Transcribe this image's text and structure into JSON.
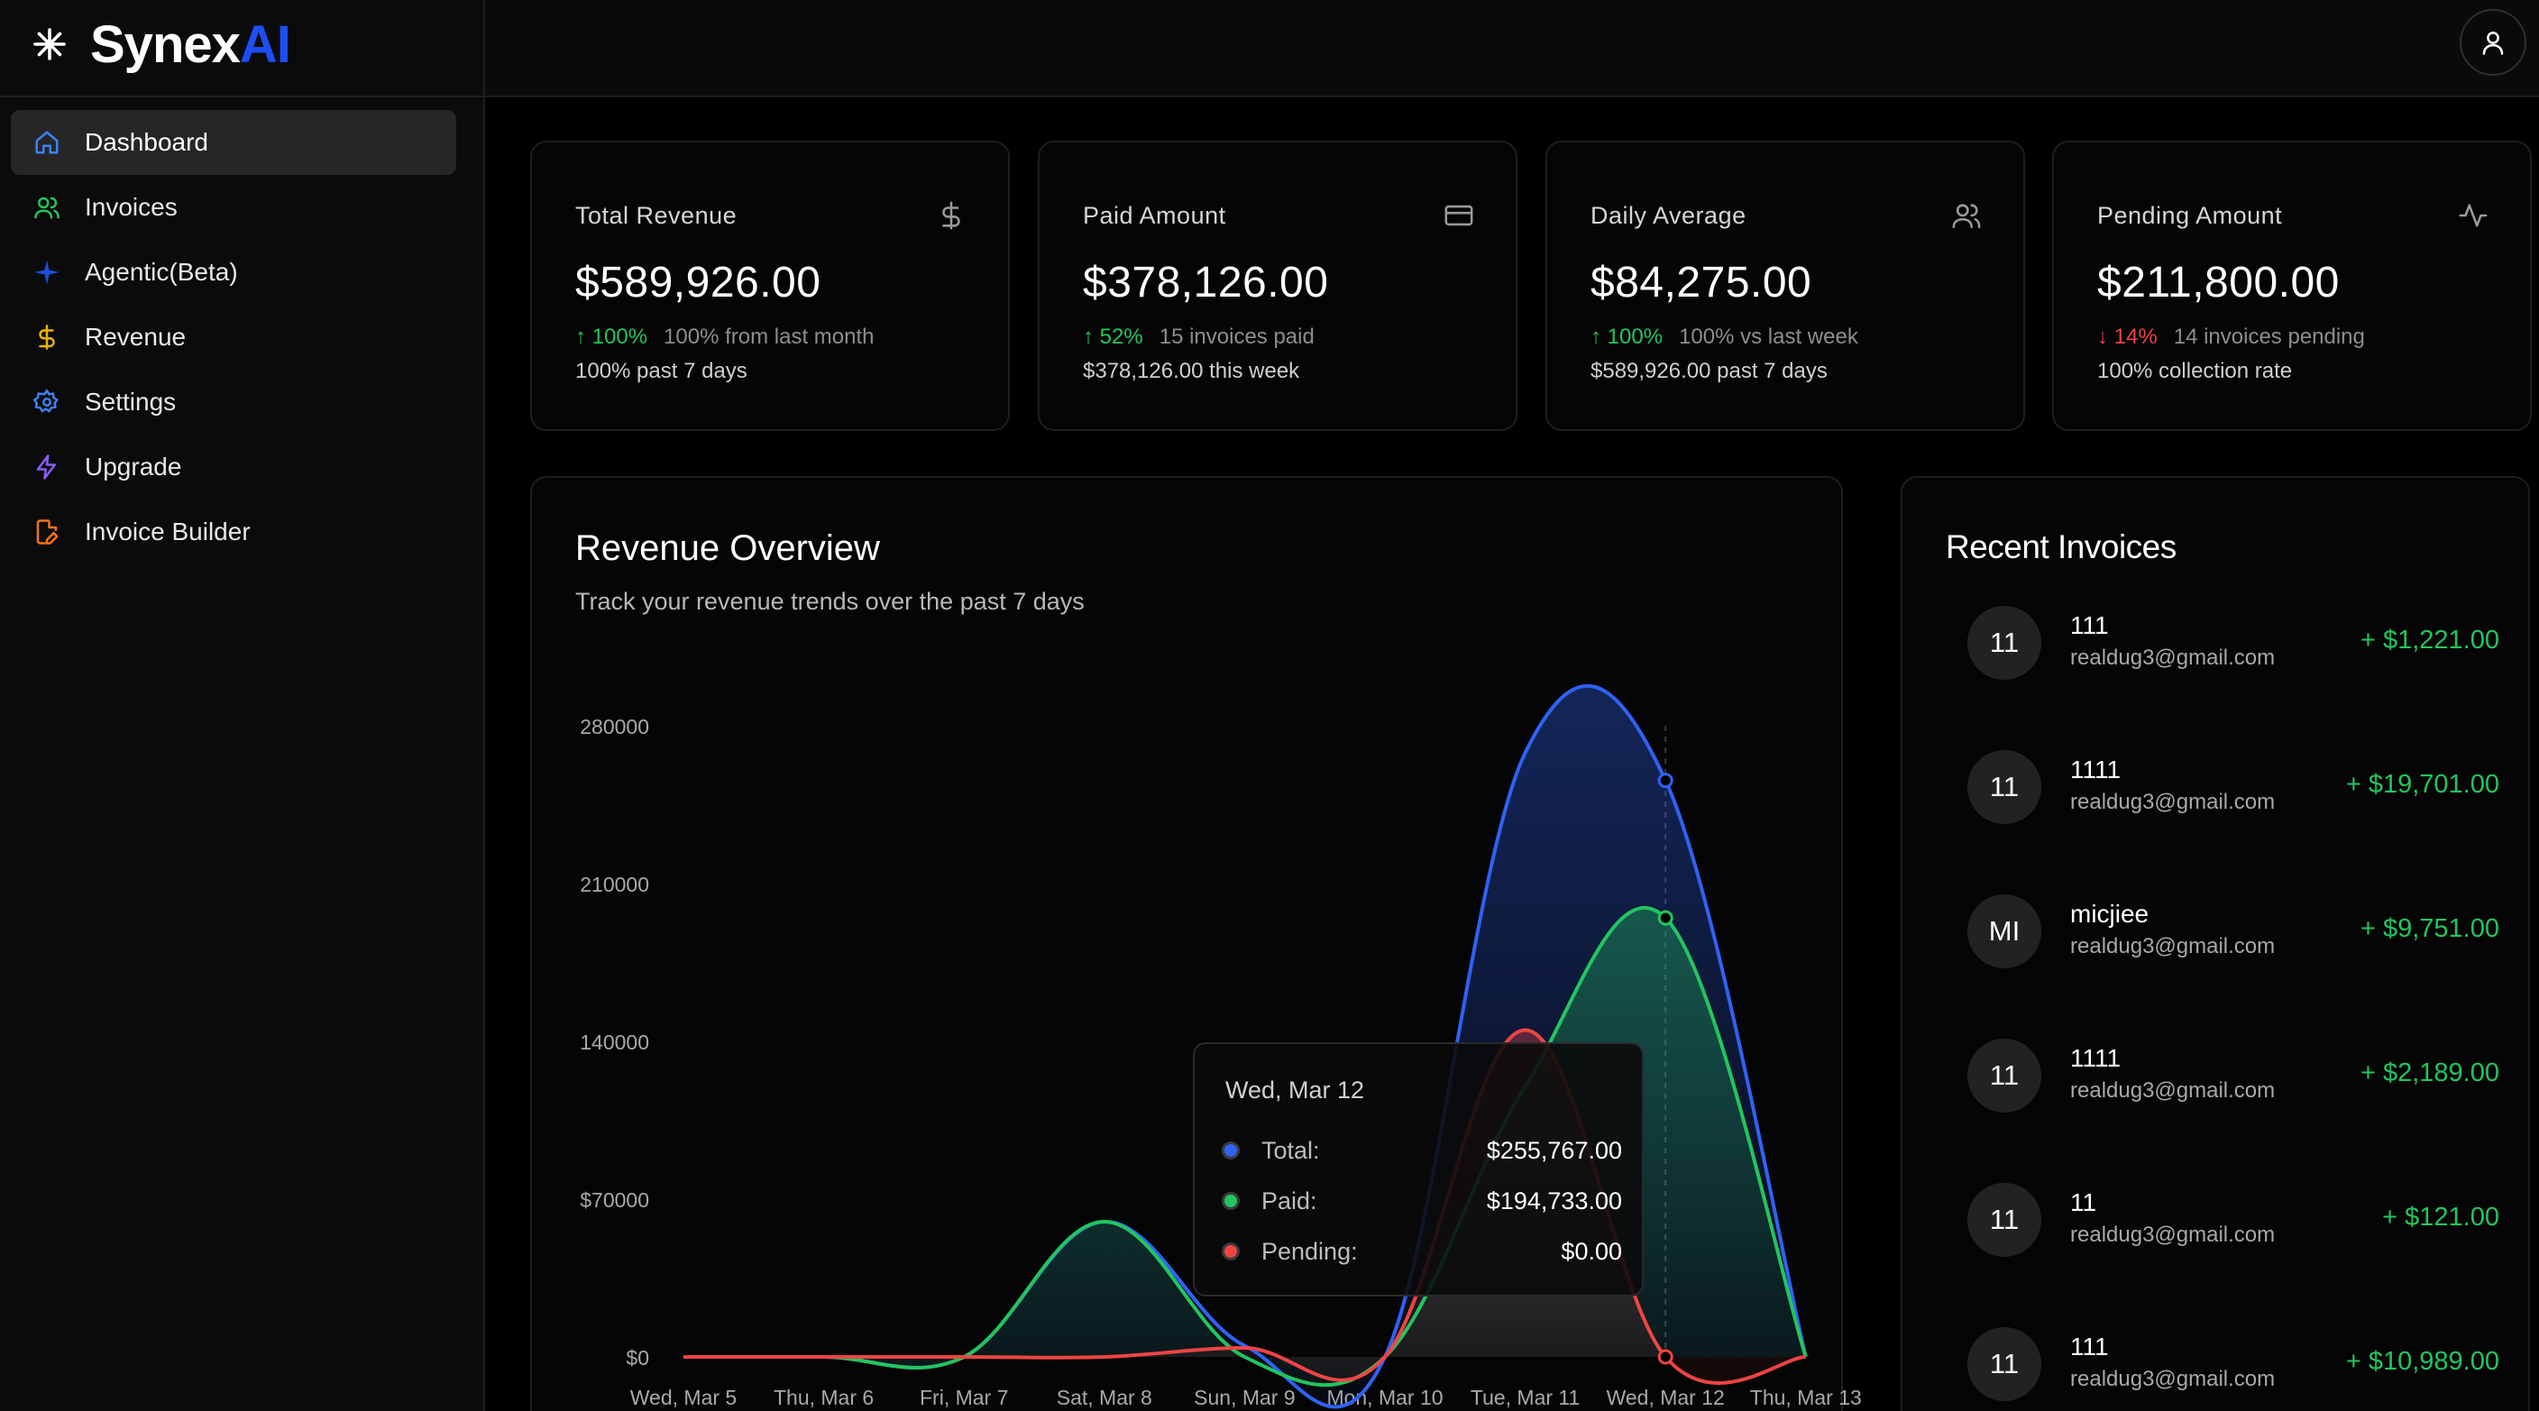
{
  "brand": {
    "name_main": "Synex",
    "name_accent": "AI"
  },
  "sidebar": {
    "items": [
      {
        "label": "Dashboard",
        "icon": "home-icon",
        "color": "#3b82f6",
        "active": true
      },
      {
        "label": "Invoices",
        "icon": "users-icon",
        "color": "#22c55e"
      },
      {
        "label": "Agentic(Beta)",
        "icon": "sparkle-icon",
        "color": "#2563eb"
      },
      {
        "label": "Revenue",
        "icon": "dollar-icon",
        "color": "#eab308"
      },
      {
        "label": "Settings",
        "icon": "gear-icon",
        "color": "#3b82f6"
      },
      {
        "label": "Upgrade",
        "icon": "lightning-icon",
        "color": "#8b5cf6"
      },
      {
        "label": "Invoice Builder",
        "icon": "file-edit-icon",
        "color": "#f97316"
      }
    ]
  },
  "topbar": {
    "user_icon": "user-icon"
  },
  "stats": [
    {
      "label": "Total Revenue",
      "icon": "dollar-icon",
      "value": "$589,926.00",
      "trend": "up",
      "pct": "100%",
      "desc": "100% from last month",
      "foot": "100% past 7 days"
    },
    {
      "label": "Paid Amount",
      "icon": "credit-card-icon",
      "value": "$378,126.00",
      "trend": "up",
      "pct": "52%",
      "desc": "15 invoices paid",
      "foot": "$378,126.00 this week"
    },
    {
      "label": "Daily Average",
      "icon": "users-icon",
      "value": "$84,275.00",
      "trend": "up",
      "pct": "100%",
      "desc": "100% vs last week",
      "foot": "$589,926.00 past 7 days"
    },
    {
      "label": "Pending Amount",
      "icon": "activity-icon",
      "value": "$211,800.00",
      "trend": "down",
      "pct": "14%",
      "desc": "14 invoices pending",
      "foot": "100% collection rate"
    }
  ],
  "overview": {
    "title": "Revenue Overview",
    "subtitle": "Track your revenue trends over the past 7 days"
  },
  "chart_data": {
    "type": "area",
    "categories": [
      "Wed, Mar 5",
      "Thu, Mar 6",
      "Fri, Mar 7",
      "Sat, Mar 8",
      "Sun, Mar 9",
      "Mon, Mar 10",
      "Tue, Mar 11",
      "Wed, Mar 12",
      "Thu, Mar 13"
    ],
    "y_ticks": [
      "280000",
      "210000",
      "140000",
      "$70000",
      "$0"
    ],
    "ylim": [
      0,
      280000
    ],
    "series": [
      {
        "name": "Total",
        "color": "#2f62f5",
        "values": [
          0,
          0,
          0,
          60000,
          5000,
          0,
          268000,
          255767,
          0
        ]
      },
      {
        "name": "Paid",
        "color": "#22c55e",
        "values": [
          0,
          0,
          0,
          60000,
          0,
          0,
          120000,
          194733,
          0
        ]
      },
      {
        "name": "Pending",
        "color": "#ef4444",
        "values": [
          0,
          0,
          0,
          0,
          4000,
          0,
          145000,
          0,
          0
        ]
      }
    ],
    "tooltip": {
      "date": "Wed, Mar 12",
      "rows": [
        {
          "label": "Total:",
          "value": "$255,767.00",
          "color": "#2f62f5"
        },
        {
          "label": "Paid:",
          "value": "$194,733.00",
          "color": "#22c55e"
        },
        {
          "label": "Pending:",
          "value": "$0.00",
          "color": "#ef4444"
        }
      ]
    },
    "grid": false,
    "legend": "none"
  },
  "recent": {
    "title": "Recent Invoices",
    "items": [
      {
        "avatar": "11",
        "name": "111",
        "email": "realdug3@gmail.com",
        "amount": "+ $1,221.00"
      },
      {
        "avatar": "11",
        "name": "1111",
        "email": "realdug3@gmail.com",
        "amount": "+ $19,701.00"
      },
      {
        "avatar": "MI",
        "name": "micjiee",
        "email": "realdug3@gmail.com",
        "amount": "+ $9,751.00"
      },
      {
        "avatar": "11",
        "name": "1111",
        "email": "realdug3@gmail.com",
        "amount": "+ $2,189.00"
      },
      {
        "avatar": "11",
        "name": "11",
        "email": "realdug3@gmail.com",
        "amount": "+ $121.00"
      },
      {
        "avatar": "11",
        "name": "111",
        "email": "realdug3@gmail.com",
        "amount": "+ $10,989.00"
      }
    ]
  }
}
